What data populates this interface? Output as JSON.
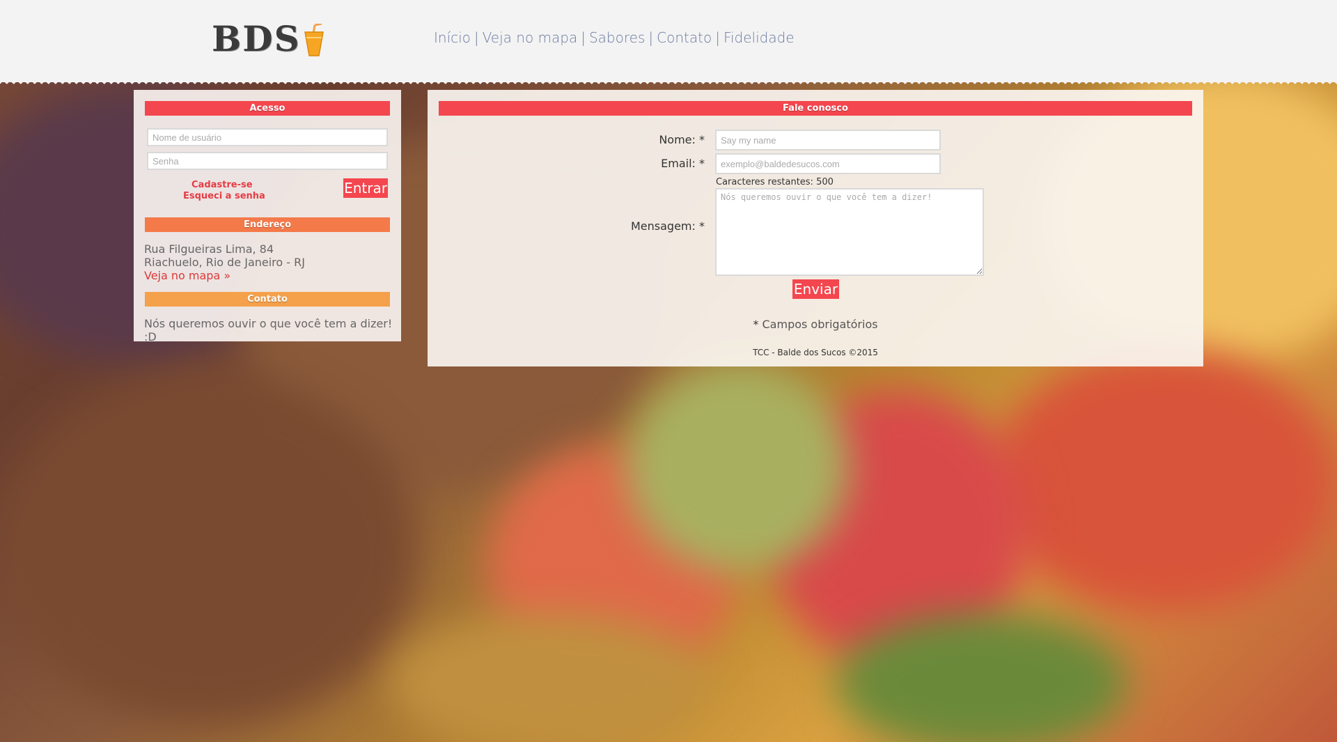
{
  "header": {
    "logo_text": "BDS",
    "nav": [
      {
        "label": "Início"
      },
      {
        "label": "Veja no mapa"
      },
      {
        "label": "Sabores"
      },
      {
        "label": "Contato"
      },
      {
        "label": "Fidelidade"
      }
    ],
    "nav_separator": "|"
  },
  "sidebar": {
    "login": {
      "title": "Acesso",
      "username_placeholder": "Nome de usuário",
      "password_placeholder": "Senha",
      "register_link": "Cadastre-se",
      "forgot_link": "Esqueci a senha",
      "submit_label": "Entrar"
    },
    "address": {
      "title": "Endereço",
      "line1": "Rua Filgueiras Lima, 84",
      "line2": "Riachuelo, Rio de Janeiro - RJ",
      "map_link": "Veja no mapa »"
    },
    "contact": {
      "title": "Contato",
      "text": "Nós queremos ouvir o que você tem a dizer! :D"
    }
  },
  "contact_form": {
    "title": "Fale conosco",
    "name_label": "Nome:",
    "name_placeholder": "Say my name",
    "email_label": "Email:",
    "email_placeholder": "exemplo@baldedesucos.com",
    "chars_remaining": "Caracteres restantes: 500",
    "message_label": "Mensagem:",
    "message_placeholder": "Nós queremos ouvir o que você tem a dizer!",
    "required_mark": "*",
    "submit_label": "Enviar",
    "required_note": "Campos obrigatórios"
  },
  "footer": {
    "text": "TCC - Balde dos Sucos ©2015"
  },
  "colors": {
    "accent_red": "#f4464e",
    "accent_orange": "#f47a4a",
    "accent_amber": "#f5a04a",
    "nav_text": "#6c7aa0"
  }
}
